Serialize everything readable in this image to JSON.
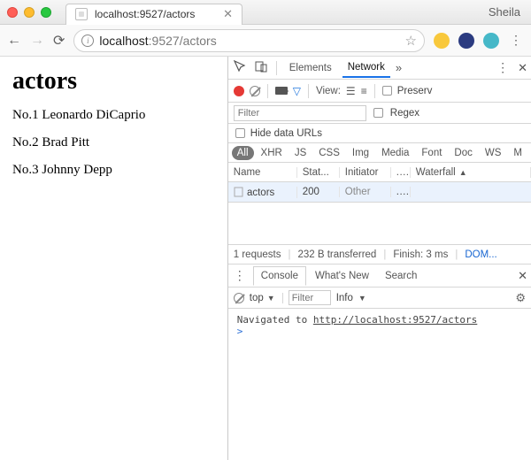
{
  "window": {
    "tab_title": "localhost:9527/actors",
    "profile": "Sheila"
  },
  "toolbar": {
    "url_host": "localhost",
    "url_rest": ":9527/actors"
  },
  "page": {
    "title": "actors",
    "items": [
      "No.1 Leonardo DiCaprio",
      "No.2 Brad Pitt",
      "No.3 Johnny Depp"
    ]
  },
  "devtools": {
    "tabs": {
      "elements": "Elements",
      "network": "Network"
    },
    "net": {
      "view_label": "View:",
      "preserve_label": "Preserv",
      "filter_placeholder": "Filter",
      "regex_label": "Regex",
      "hide_label": "Hide data URLs",
      "types": {
        "all": "All",
        "xhr": "XHR",
        "js": "JS",
        "css": "CSS",
        "img": "Img",
        "media": "Media",
        "font": "Font",
        "doc": "Doc",
        "ws": "WS",
        "m": "M"
      },
      "cols": {
        "name": "Name",
        "status": "Stat...",
        "initiator": "Initiator",
        "dots": "...",
        "waterfall": "Waterfall"
      },
      "row": {
        "name": "actors",
        "status": "200",
        "initiator": "Other",
        "dots": "..."
      },
      "summary": {
        "requests": "1 requests",
        "transferred": "232 B transferred",
        "finish": "Finish: 3 ms",
        "dom": "DOM..."
      }
    },
    "drawer": {
      "tabs": {
        "console": "Console",
        "whatsnew": "What's New",
        "search": "Search"
      },
      "context": "top",
      "filter_placeholder": "Filter",
      "level": "Info",
      "log_prefix": "Navigated to ",
      "log_url": "http://localhost:9527/actors",
      "prompt": ">"
    }
  },
  "icons": {
    "back": "←",
    "forward": "→",
    "reload": "⟳",
    "star": "☆",
    "kebab": "⋮",
    "chev": "»",
    "close": "✕",
    "funnel": "▽",
    "list": "☰",
    "list2": "≡",
    "gear": "⚙",
    "tridown": "▼",
    "triup": "▲"
  }
}
